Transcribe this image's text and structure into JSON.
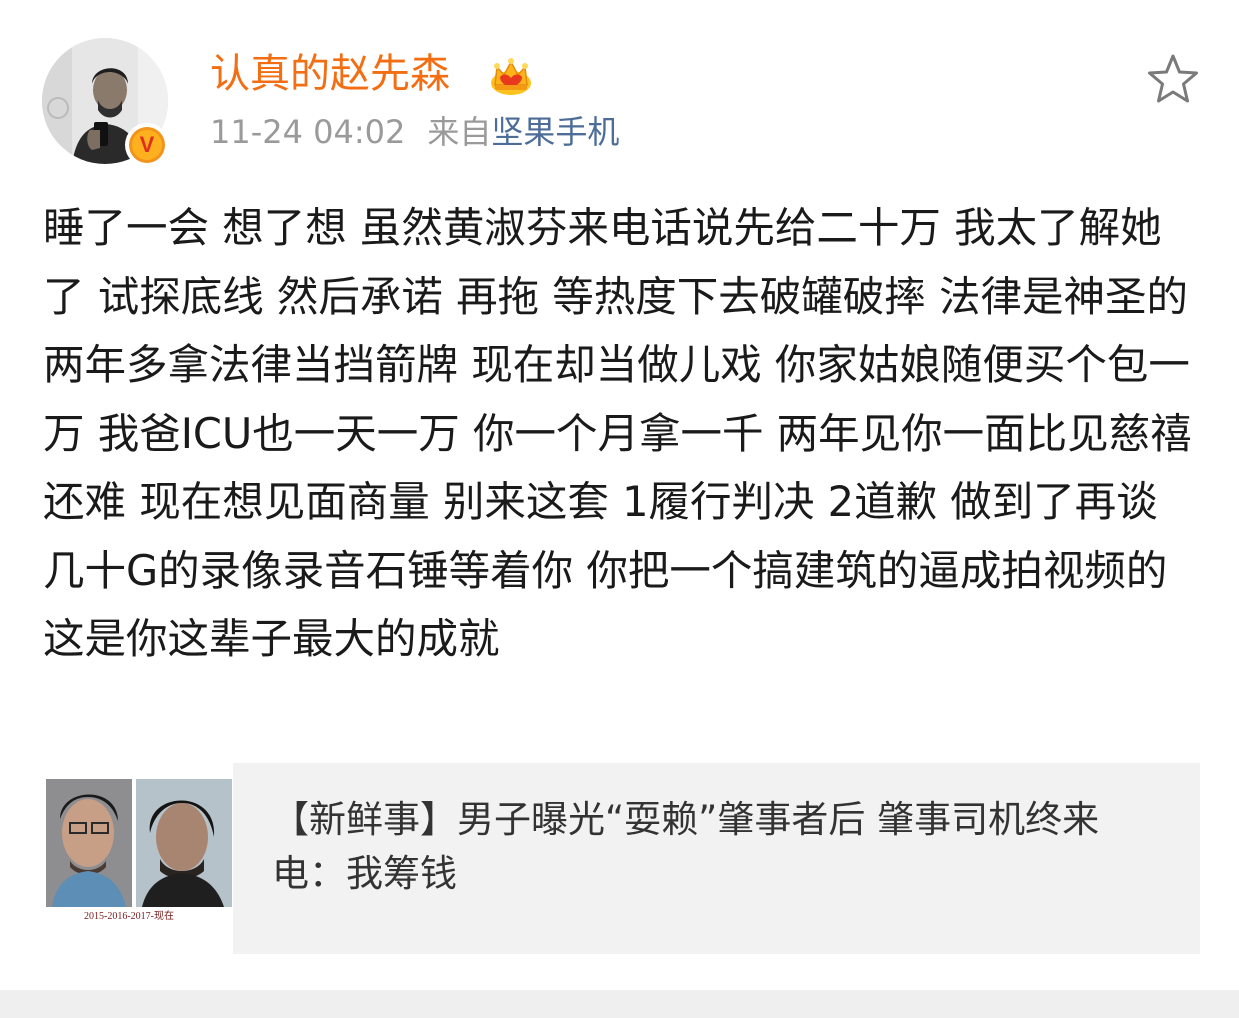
{
  "post": {
    "author": "认真的赵先森",
    "timestamp": "11-24 04:02",
    "source_prefix": "来自",
    "source_name": "坚果手机",
    "text": "睡了一会 想了想 虽然黄淑芬来电话说先给二十万 我太了解她了 试探底线 然后承诺 再拖 等热度下去破罐破摔 法律是神圣的 两年多拿法律当挡箭牌 现在却当做儿戏 你家姑娘随便买个包一万 我爸ICU也一天一万 你一个月拿一千 两年见你一面比见慈禧还难 现在想见面商量 别来这套 1履行判决 2道歉 做到了再谈 几十G的录像录音石锤等着你 你把一个搞建筑的逼成拍视频的 这是你这辈子最大的成就",
    "avatar_icon": "user-avatar-photo",
    "verified_badge": "V",
    "crown_icon": "member-crown-icon",
    "favorite_icon": "star-icon"
  },
  "card": {
    "title": "【新鲜事】男子曝光“耍赖”肇事者后 肇事司机终来电：我筹钱",
    "thumb_caption": "2015-2016-2017-现在"
  },
  "colors": {
    "username": "#f36d12",
    "link": "#4d6d98",
    "meta": "#9a9a9a",
    "card_bg": "#f2f2f2"
  }
}
